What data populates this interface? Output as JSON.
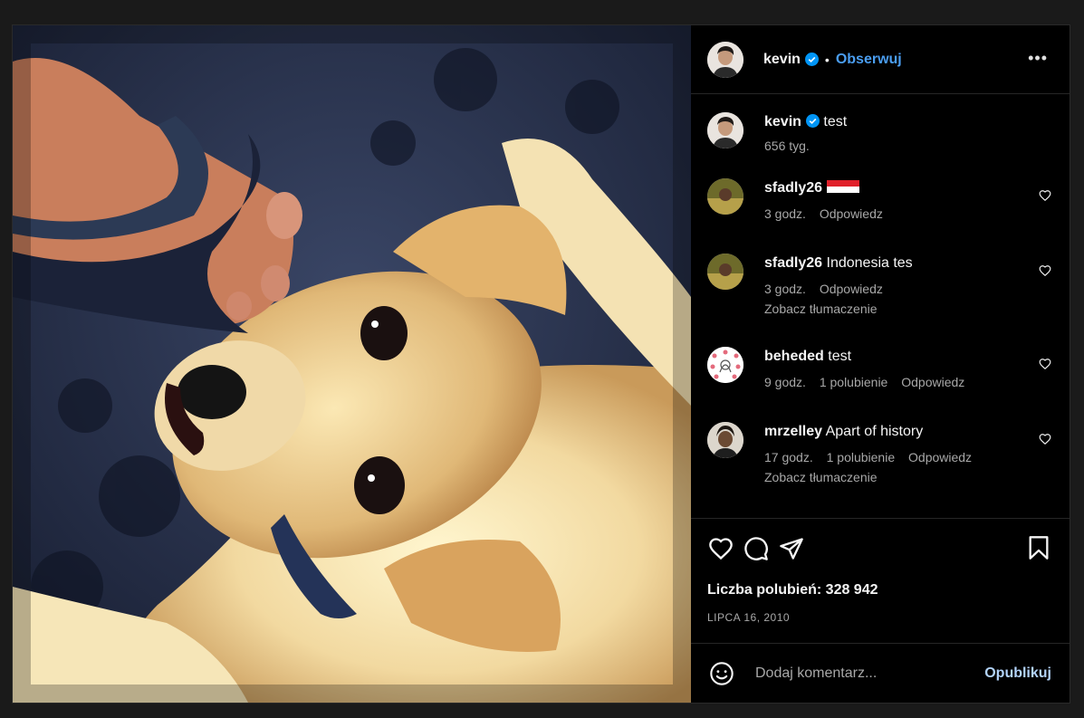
{
  "post": {
    "author": "kevin",
    "follow_label": "Obserwuj",
    "dot": "•",
    "more_label": "•••",
    "caption": {
      "username": "kevin",
      "text": "test",
      "time": "656 tyg."
    },
    "comments": [
      {
        "username": "sfadly26",
        "text": "",
        "flag": "indonesia-flag-icon",
        "time": "3 godz.",
        "likes": "",
        "reply": "Odpowiedz",
        "translate": ""
      },
      {
        "username": "sfadly26",
        "text": "Indonesia tes",
        "flag": "",
        "time": "3 godz.",
        "likes": "",
        "reply": "Odpowiedz",
        "translate": "Zobacz tłumaczenie"
      },
      {
        "username": "beheded",
        "text": "test",
        "flag": "",
        "time": "9 godz.",
        "likes": "1 polubienie",
        "reply": "Odpowiedz",
        "translate": ""
      },
      {
        "username": "mrzelley",
        "text": "Apart of history",
        "flag": "",
        "time": "17 godz.",
        "likes": "1 polubienie",
        "reply": "Odpowiedz",
        "translate": "Zobacz tłumaczenie"
      }
    ],
    "likes_label": "Liczba polubień: 328 942",
    "date": "LIPCA 16, 2010",
    "comment_placeholder": "Dodaj komentarz...",
    "publish_label": "Opublikuj"
  },
  "colors": {
    "accent": "#4a9df0",
    "publish": "#b3d4fb",
    "background": "#000000",
    "muted": "#a8a8a8"
  }
}
